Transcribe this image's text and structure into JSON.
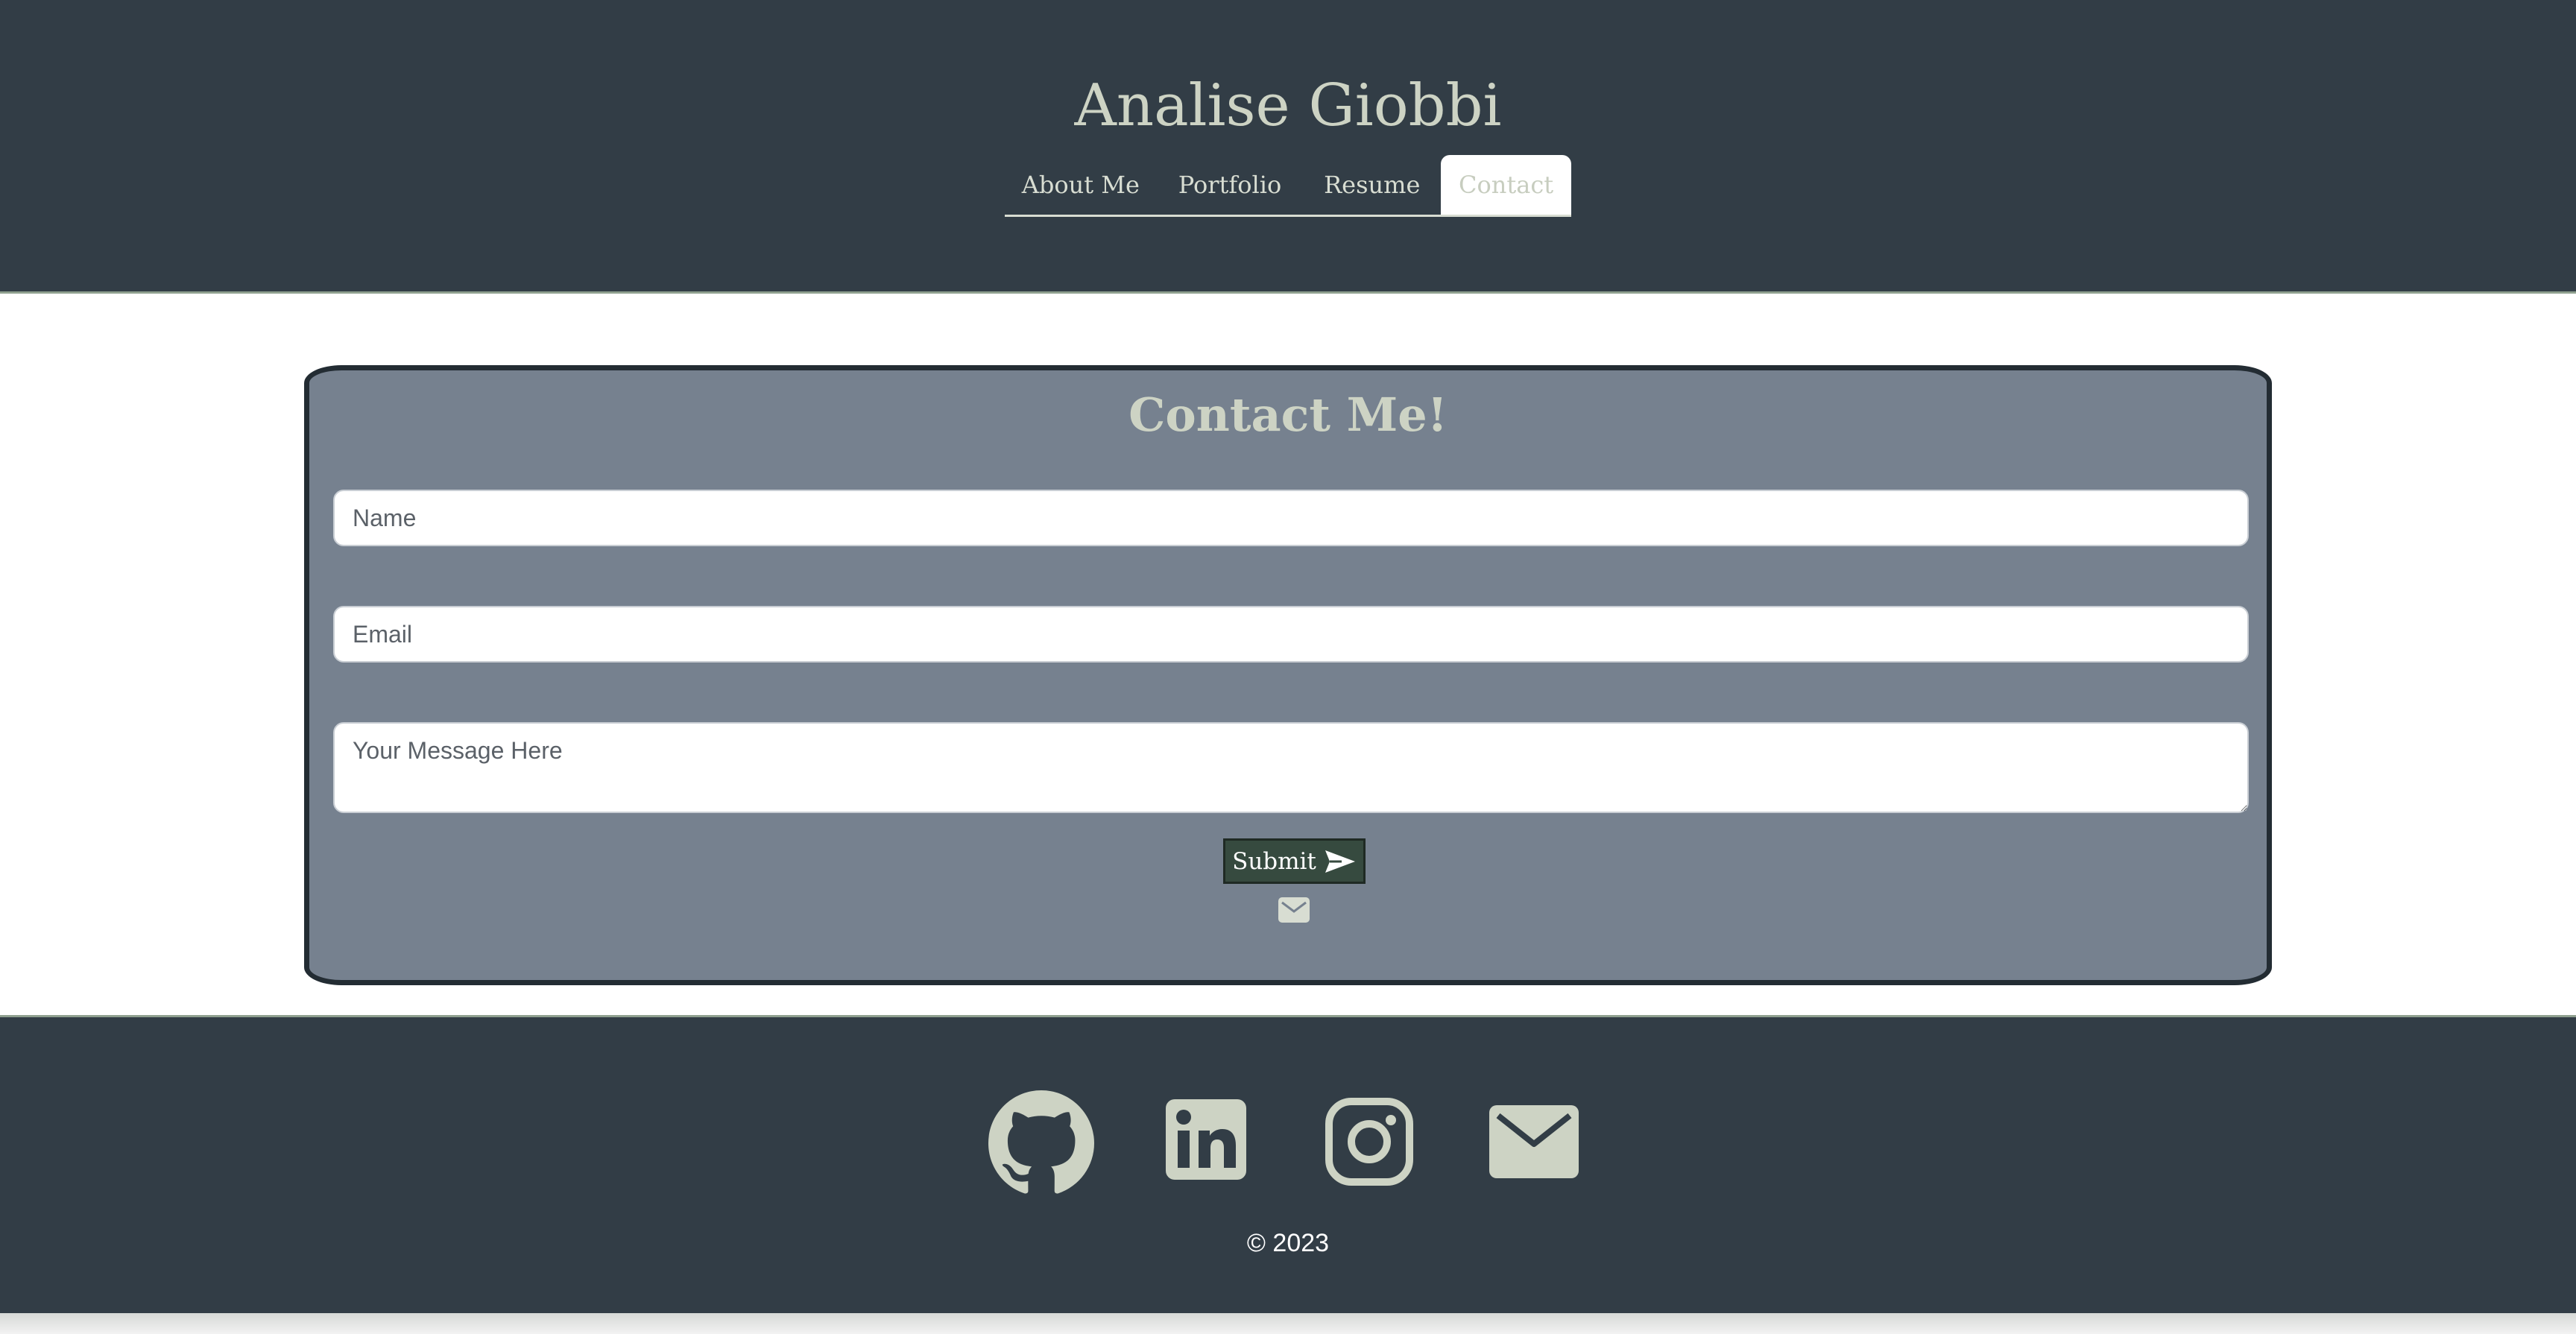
{
  "header": {
    "site_title": "Analise Giobbi",
    "nav": [
      {
        "label": "About Me",
        "active": false
      },
      {
        "label": "Portfolio",
        "active": false
      },
      {
        "label": "Resume",
        "active": false
      },
      {
        "label": "Contact",
        "active": true
      }
    ]
  },
  "contact_form": {
    "heading": "Contact Me!",
    "name_placeholder": "Name",
    "email_placeholder": "Email",
    "message_placeholder": "Your Message Here",
    "submit_label": "Submit",
    "submit_icon": "send-icon",
    "status_icon": "mail-icon"
  },
  "footer": {
    "social_icons": [
      "github-icon",
      "linkedin-icon",
      "instagram-icon",
      "mail-icon"
    ],
    "copyright": "© 2023"
  },
  "colors": {
    "header_bg": "#323d46",
    "card_bg": "#76818f",
    "accent_text": "#cdd3c4",
    "submit_bg": "#364a3f"
  }
}
